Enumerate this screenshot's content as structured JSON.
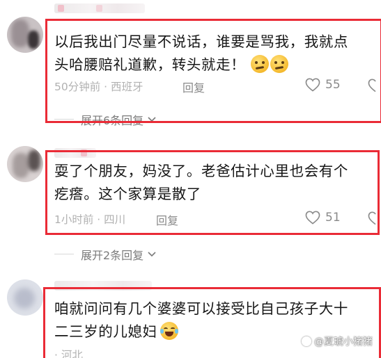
{
  "comments": [
    {
      "text_lines": [
        "以后我出门尽量不说话，谁要是骂我，我就点",
        "头哈腰赔礼道歉，转头就走！"
      ],
      "emojis": [
        "thinking-face-emoji",
        "thinking-face-emoji"
      ],
      "time": "50分钟前",
      "location": "西班牙",
      "reply_label": "回复",
      "likes": "55",
      "expand_label": "展开6条回复"
    },
    {
      "text_lines": [
        "耍了个朋友，妈没了。老爸估计心里也会有个",
        "疙瘩。这个家算是散了"
      ],
      "emojis": [],
      "time": "1小时前",
      "location": "四川",
      "reply_label": "回复",
      "likes": "51",
      "expand_label": "展开2条回复"
    },
    {
      "text_lines": [
        "咱就问问有几个婆婆可以接受比自己孩子大十",
        "二三岁的儿媳妇"
      ],
      "emojis": [
        "tears-of-joy-emoji"
      ],
      "time": "",
      "location": "河北",
      "reply_label": "",
      "likes": "",
      "expand_label": ""
    }
  ],
  "watermark": "@夏琥小猪猪",
  "colors": {
    "highlight_box": "#ea2b36",
    "meta_text": "#b1b1b1",
    "action_text": "#8a8a8a"
  }
}
